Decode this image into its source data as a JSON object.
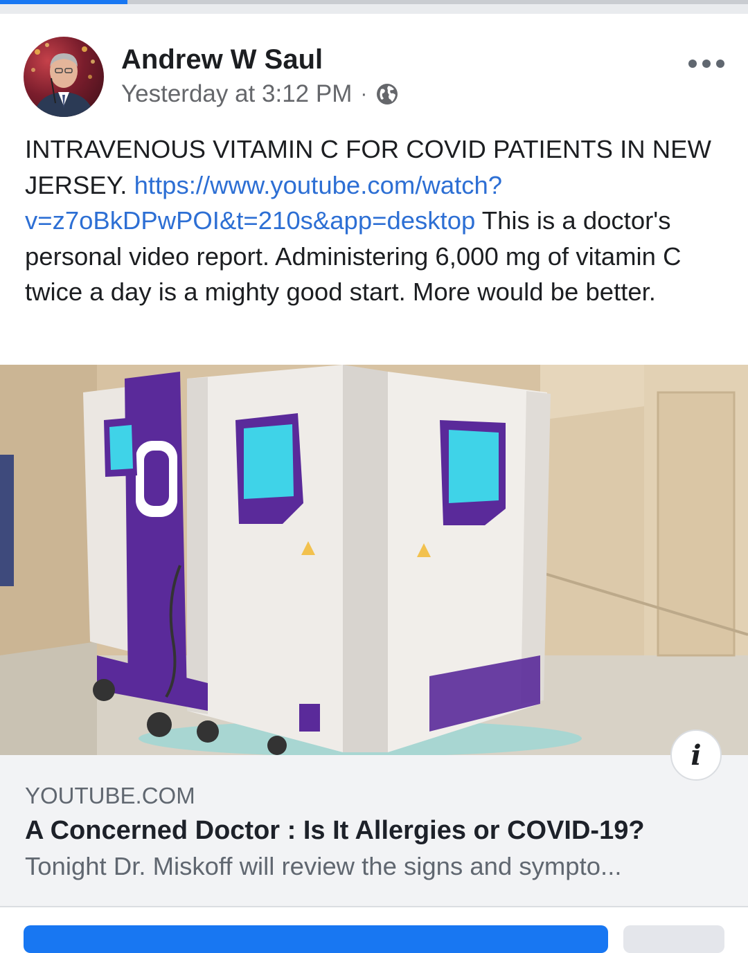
{
  "loading": {
    "progress_percent": 17
  },
  "post": {
    "author_name": "Andrew W Saul",
    "timestamp": "Yesterday at 3:12 PM",
    "separator": "·",
    "privacy_icon": "globe-icon",
    "more_icon": "more-horizontal-icon",
    "text_before_link": "INTRAVENOUS VITAMIN C FOR COVID PATIENTS IN NEW JERSEY. ",
    "link_text": "https://www.youtube.com/watch?v=z7oBkDPwPOI&t=210s&app=desktop",
    "text_after_link": " This is a doctor's personal video report. Administering 6,000 mg of vitamin C twice a day is a mighty good start. More would be better."
  },
  "link_preview": {
    "domain": "YOUTUBE.COM",
    "title": "A Concerned Doctor : Is It Allergies or COVID-19?",
    "description": "Tonight Dr. Miskoff will review the signs and sympto...",
    "info_label": "i"
  },
  "colors": {
    "link": "#2d6fd4",
    "primary_button": "#1877f2",
    "uv_purple": "#5a2a9a",
    "uv_cyan": "#3fd3e8"
  }
}
